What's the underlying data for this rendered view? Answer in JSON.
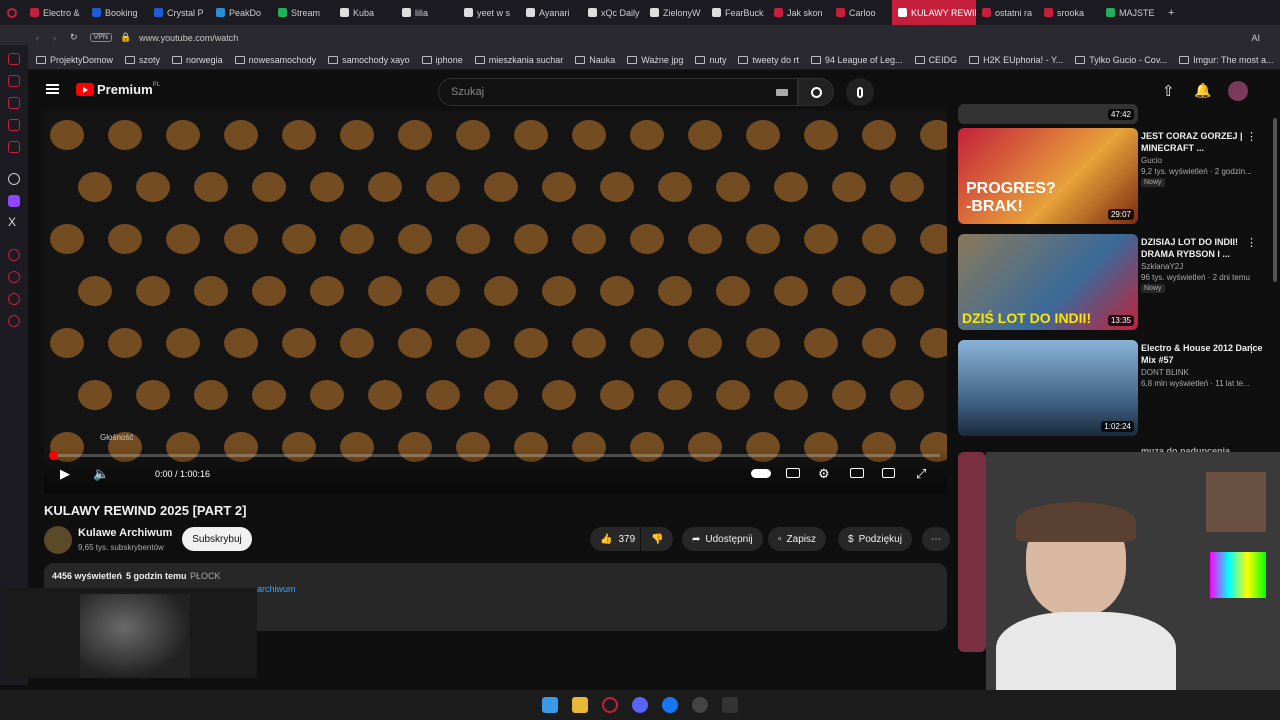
{
  "browser": {
    "tabs": [
      {
        "label": "Electro &",
        "color": "#c4203b"
      },
      {
        "label": "Booking",
        "color": "#1e5bd6"
      },
      {
        "label": "Crystal P",
        "color": "#1e5bd6"
      },
      {
        "label": "PeakDo",
        "color": "#2b8fd6"
      },
      {
        "label": "Stream",
        "color": "#21b05b"
      },
      {
        "label": "Kuba",
        "color": "#dddddd"
      },
      {
        "label": "lilia",
        "color": "#dddddd"
      },
      {
        "label": "yeet w s",
        "color": "#dddddd"
      },
      {
        "label": "Ayanari",
        "color": "#dddddd"
      },
      {
        "label": "xQc Daily",
        "color": "#dddddd"
      },
      {
        "label": "ZielonyW",
        "color": "#dddddd"
      },
      {
        "label": "FearBuck",
        "color": "#dddddd"
      },
      {
        "label": "Jak skon",
        "color": "#c4203b"
      },
      {
        "label": "Carloo",
        "color": "#c4203b"
      },
      {
        "label": "KULAWY REWIN",
        "color": "#ffffff",
        "active": true
      },
      {
        "label": "ostatni ra",
        "color": "#c4203b"
      },
      {
        "label": "srooka",
        "color": "#c4203b"
      },
      {
        "label": "MAJSTE",
        "color": "#21b05b"
      }
    ],
    "url": "www.youtube.com/watch",
    "vpn_label": "VPN",
    "ai_label": "AI",
    "bookmarks": [
      "ProjektyDomow",
      "szoty",
      "norwegia",
      "nowesamochody",
      "samochody xayo",
      "iphone",
      "mieszkania suchar",
      "Nauka",
      "Ważne jpg",
      "nuty",
      "tweety do rt",
      "94 League of Leg...",
      "CEIDG",
      "H2K EUphoria! - Y...",
      "Tylko Gucio - Cov...",
      "Imgur: The most a..."
    ]
  },
  "youtube": {
    "logo_text": "Premium",
    "logo_region": "PL",
    "search_placeholder": "Szukaj",
    "player": {
      "volume_tooltip": "Głośność",
      "time": "0:00 / 1:00:16",
      "progress_fraction": 0.0
    },
    "video": {
      "title": "KULAWY REWIND 2025 [PART 2]",
      "channel": "Kulawe Archiwum",
      "subscribers": "9,65 tys. subskrybentów",
      "subscribe_label": "Subskrybuj",
      "likes": "379",
      "share_label": "Udostępnij",
      "save_label": "Zapisz",
      "thanks_label": "Podziękuj",
      "views": "4456 wyświetleń",
      "age": "5 godzin temu",
      "location": "PŁOCK",
      "desc_link": "archiwum"
    },
    "recommendations": [
      {
        "duration_top": "47:42"
      },
      {
        "title": "JEST CORAZ GORZEJ | MINECRAFT ...",
        "channel": "Gucio",
        "meta": "9,2 tys. wyświetleń · 2 godzin...",
        "badge": "Nowy",
        "duration": "29:07",
        "thumb_text": "PROGRES? -BRAK!"
      },
      {
        "title": "DZISIAJ LOT DO INDII! DRAMA RYBSON I ...",
        "channel": "SzklanaY2J",
        "meta": "96 tys. wyświetleń · 2 dni temu",
        "badge": "Nowy",
        "duration": "13:35",
        "thumb_text": "DZIŚ LOT DO INDII!"
      },
      {
        "title": "Electro & House 2012 Dance Mix #57",
        "channel": "DONT BLINK",
        "meta": "6,8 mln wyświetleń · 11 lat te...",
        "duration": "1:02:24"
      },
      {
        "title": "muza do padupcenia"
      }
    ]
  }
}
